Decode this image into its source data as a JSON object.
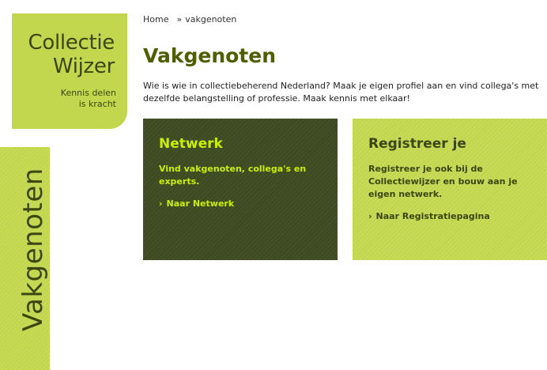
{
  "logo": {
    "title_line1": "Collectie",
    "title_line2": "Wijzer",
    "tagline_line1": "Kennis delen",
    "tagline_line2": "is kracht"
  },
  "side_tab": {
    "label": "Vakgenoten"
  },
  "breadcrumb": {
    "home": "Home",
    "separator": "»",
    "current": "vakgenoten"
  },
  "page": {
    "title": "Vakgenoten",
    "intro": "Wie is wie in collectiebeherend Nederland? Maak je eigen profiel aan en vind collega's met dezelfde belangstelling of professie. Maak kennis met elkaar!"
  },
  "cards": [
    {
      "title": "Netwerk",
      "text": "Vind vakgenoten, collega's en experts.",
      "link_label": "Naar Netwerk",
      "link_glyph": "›"
    },
    {
      "title": "Registreer je",
      "text": "Registreer je ook bij de Collectiewijzer en bouw aan je eigen netwerk.",
      "link_label": "Naar Registratiepagina",
      "link_glyph": "›"
    }
  ],
  "colors": {
    "lime": "#c3d74e",
    "dark_green": "#3e4a20",
    "accent_yellow": "#c9f000",
    "title_green": "#4e5e00"
  }
}
